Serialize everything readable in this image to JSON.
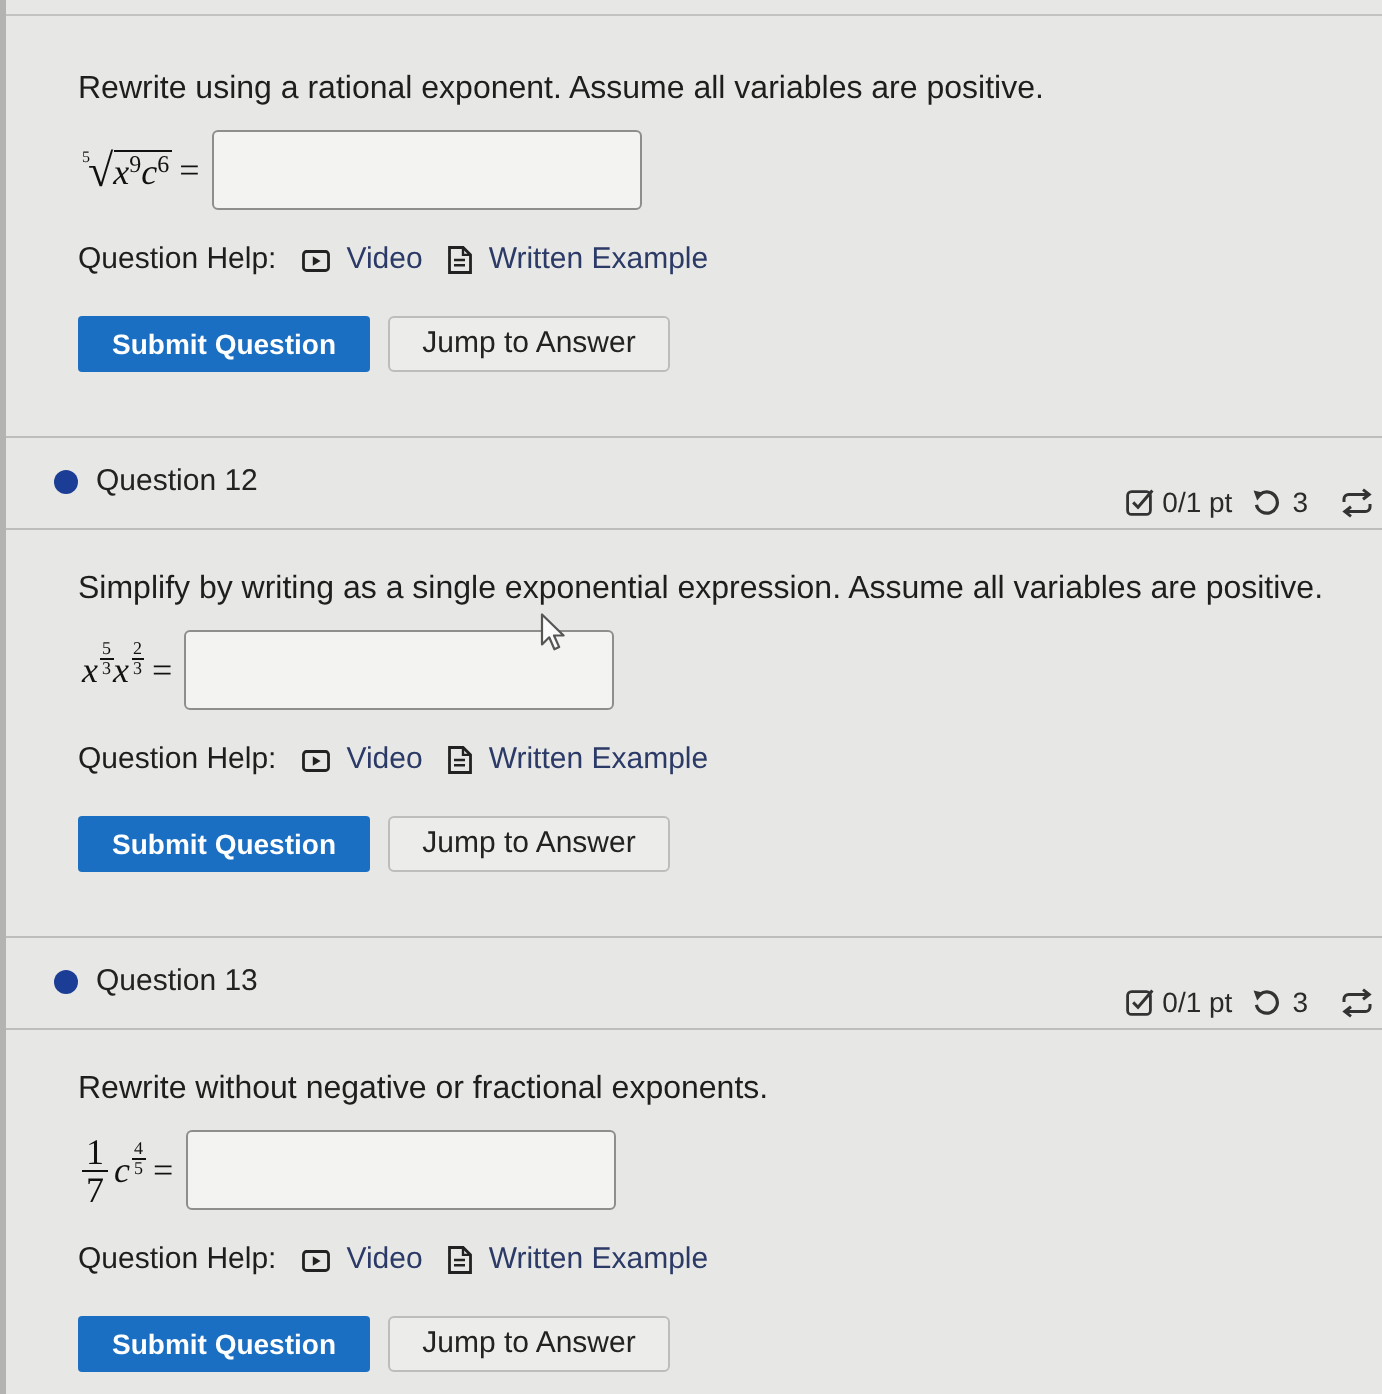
{
  "questions": [
    {
      "prompt": "Rewrite using a rational exponent. Assume all variables are positive.",
      "math": [
        {
          "kind": "root",
          "index": "5",
          "sign": "√",
          "radicand": [
            {
              "kind": "power",
              "base": "x",
              "exp": "9"
            },
            {
              "kind": "power",
              "base": "c",
              "exp": "6"
            }
          ]
        },
        {
          "kind": "text",
          "text": "="
        }
      ],
      "answer": {
        "hovered": false
      },
      "help": {
        "label": "Question Help:",
        "links": [
          {
            "kind": "video",
            "label": "Video"
          },
          {
            "kind": "document",
            "label": "Written Example"
          }
        ]
      },
      "buttons": [
        {
          "kind": "primary",
          "label": "Submit Question"
        },
        {
          "kind": "secondary",
          "label": "Jump to Answer"
        }
      ]
    },
    {
      "header": {
        "title": "Question 12",
        "score": "0/1 pt",
        "attempts": "3"
      },
      "prompt": "Simplify by writing as a single exponential expression. Assume all variables are positive.",
      "math": [
        {
          "kind": "frac_power",
          "base": "x",
          "num": "5",
          "den": "3"
        },
        {
          "kind": "frac_power",
          "base": "x",
          "num": "2",
          "den": "3"
        },
        {
          "kind": "text",
          "text": "="
        }
      ],
      "answer": {
        "hovered": true
      },
      "help": {
        "label": "Question Help:",
        "links": [
          {
            "kind": "video",
            "label": "Video"
          },
          {
            "kind": "document",
            "label": "Written Example"
          }
        ]
      },
      "buttons": [
        {
          "kind": "primary",
          "label": "Submit Question"
        },
        {
          "kind": "secondary",
          "label": "Jump to Answer"
        }
      ]
    },
    {
      "header": {
        "title": "Question 13",
        "score": "0/1 pt",
        "attempts": "3"
      },
      "prompt": "Rewrite without negative or fractional exponents.",
      "math": [
        {
          "kind": "frac",
          "num": "1",
          "den": "7"
        },
        {
          "kind": "frac_power",
          "base": "c",
          "num": "4",
          "den": "5"
        },
        {
          "kind": "text",
          "text": "="
        }
      ],
      "answer": {
        "hovered": false
      },
      "help": {
        "label": "Question Help:",
        "links": [
          {
            "kind": "video",
            "label": "Video"
          },
          {
            "kind": "document",
            "label": "Written Example"
          }
        ]
      },
      "buttons": [
        {
          "kind": "primary",
          "label": "Submit Question"
        },
        {
          "kind": "secondary",
          "label": "Jump to Answer"
        }
      ]
    }
  ]
}
